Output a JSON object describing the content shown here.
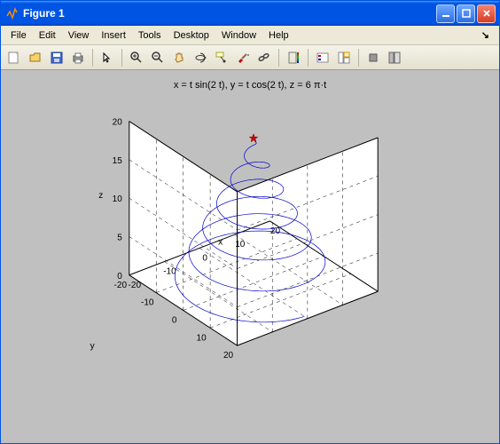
{
  "window": {
    "title": "Figure 1"
  },
  "menu": {
    "items": [
      "File",
      "Edit",
      "View",
      "Insert",
      "Tools",
      "Desktop",
      "Window",
      "Help"
    ]
  },
  "toolbar": {
    "icons": [
      "new-figure-icon",
      "open-icon",
      "save-icon",
      "print-icon",
      "|",
      "pointer-icon",
      "|",
      "zoom-in-icon",
      "zoom-out-icon",
      "pan-icon",
      "rotate3d-icon",
      "data-cursor-icon",
      "brush-icon",
      "link-icon",
      "|",
      "colorbar-icon",
      "|",
      "legend-icon",
      "plot-tools-icon",
      "|",
      "hide-tools-icon",
      "show-tools-icon"
    ]
  },
  "chart_data": {
    "type": "line",
    "title": "x = t sin(2 t), y = t cos(2 t), z = 6 π·t",
    "parametric": {
      "t_range": [
        0,
        18.85
      ],
      "x": "t*sin(2*t)",
      "y": "t*cos(2*t)",
      "z": "6*pi - t"
    },
    "axes": {
      "x": {
        "label": "x",
        "ticks": [
          -20,
          -10,
          0,
          10,
          20
        ],
        "lim": [
          -20,
          20
        ]
      },
      "y": {
        "label": "y",
        "ticks": [
          -20,
          -10,
          0,
          10,
          20
        ],
        "lim": [
          -20,
          20
        ]
      },
      "z": {
        "label": "z",
        "ticks": [
          0,
          5,
          10,
          15,
          20
        ],
        "lim": [
          0,
          20
        ]
      }
    },
    "marker": {
      "t": 0,
      "symbol": "*",
      "color": "#cc0000"
    },
    "view": {
      "azimuth": -37.5,
      "elevation": 30
    }
  }
}
